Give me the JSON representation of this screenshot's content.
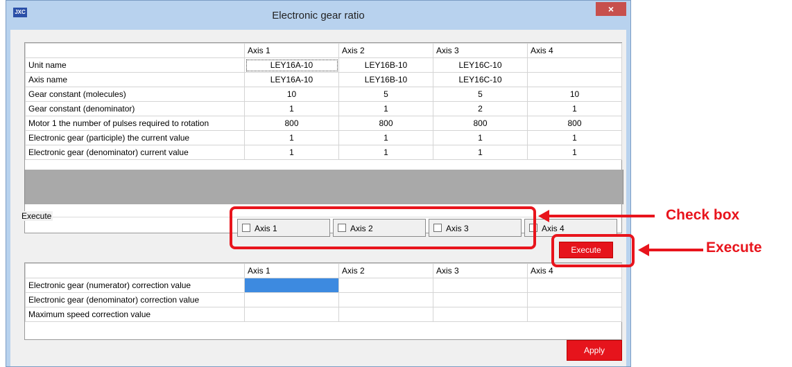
{
  "window": {
    "title": "Electronic gear ratio",
    "app_icon_text": "JXC",
    "close_glyph": "×"
  },
  "top_table": {
    "columns": [
      "",
      "Axis 1",
      "Axis 2",
      "Axis 3",
      "Axis 4"
    ],
    "rows": [
      [
        "Unit name",
        "LEY16A-10",
        "LEY16B-10",
        "LEY16C-10",
        ""
      ],
      [
        "Axis name",
        "LEY16A-10",
        "LEY16B-10",
        "LEY16C-10",
        ""
      ],
      [
        "Gear constant (molecules)",
        "10",
        "5",
        "5",
        "10"
      ],
      [
        "Gear constant (denominator)",
        "1",
        "1",
        "2",
        "1"
      ],
      [
        "Motor 1 the number of pulses required to rotation",
        "800",
        "800",
        "800",
        "800"
      ],
      [
        "Electronic gear (participle) the current value",
        "1",
        "1",
        "1",
        "1"
      ],
      [
        "Electronic gear (denominator) current value",
        "1",
        "1",
        "1",
        "1"
      ]
    ]
  },
  "execute_group": {
    "label": "Execute",
    "axes": [
      "Axis 1",
      "Axis 2",
      "Axis 3",
      "Axis 4"
    ],
    "execute_button": "Execute"
  },
  "bottom_table": {
    "columns": [
      "",
      "Axis 1",
      "Axis 2",
      "Axis 3",
      "Axis 4"
    ],
    "rows": [
      [
        "Electronic gear (numerator) correction value",
        "",
        "",
        "",
        ""
      ],
      [
        "Electronic gear (denominator) correction value",
        "",
        "",
        "",
        ""
      ],
      [
        "Maximum speed correction value",
        "",
        "",
        "",
        ""
      ]
    ]
  },
  "apply_button": "Apply",
  "annotations": {
    "checkbox": "Check box",
    "execute": "Execute"
  },
  "colors": {
    "accent_red": "#e8141c",
    "button_red": "#e6141c",
    "selected_cell": "#3d8ae0",
    "title_bar": "#b8d2ee"
  }
}
